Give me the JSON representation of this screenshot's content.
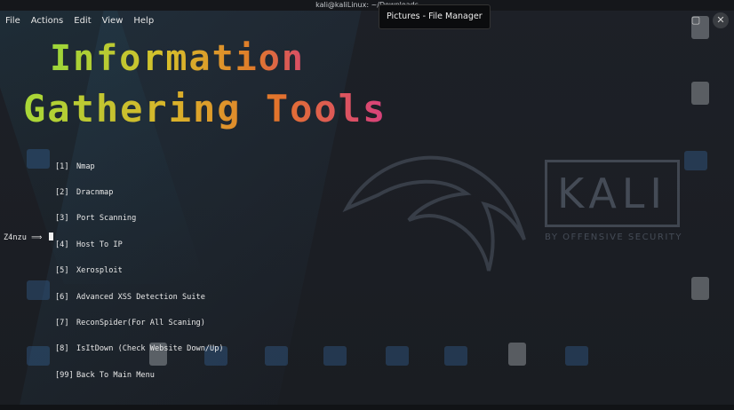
{
  "window": {
    "title": "kali@kaliLinux: ~/Downloads",
    "tooltip": "Pictures - File Manager"
  },
  "menubar": {
    "items": [
      "File",
      "Actions",
      "Edit",
      "View",
      "Help"
    ]
  },
  "banner": {
    "line1": "Information",
    "line2": "Gathering Tools"
  },
  "menu": {
    "items": [
      {
        "num": "[1]",
        "label": "Nmap"
      },
      {
        "num": "[2]",
        "label": "Dracnmap"
      },
      {
        "num": "[3]",
        "label": "Port Scanning"
      },
      {
        "num": "[4]",
        "label": "Host To IP"
      },
      {
        "num": "[5]",
        "label": "Xerosploit"
      },
      {
        "num": "[6]",
        "label": "Advanced XSS Detection Suite"
      },
      {
        "num": "[7]",
        "label": "ReconSpider(For All Scaning)"
      },
      {
        "num": "[8]",
        "label": "IsItDown (Check Website Down/Up)"
      },
      {
        "num": "[99]",
        "label": "Back To Main Menu"
      }
    ]
  },
  "prompt": {
    "text": "Z4nzu",
    "arrow": "⟹"
  },
  "desktop": {
    "logo_text": "KALI",
    "logo_sub": "BY OFFENSIVE SECURITY"
  },
  "icons": {
    "close": "close-icon",
    "maximize": "maximize-icon"
  },
  "colors": {
    "background": "#1b1e24",
    "terminal_text": "#e8e8e8",
    "banner_green": "#9bd63a",
    "banner_orange": "#e07a2a",
    "banner_pink": "#d84b6a"
  }
}
